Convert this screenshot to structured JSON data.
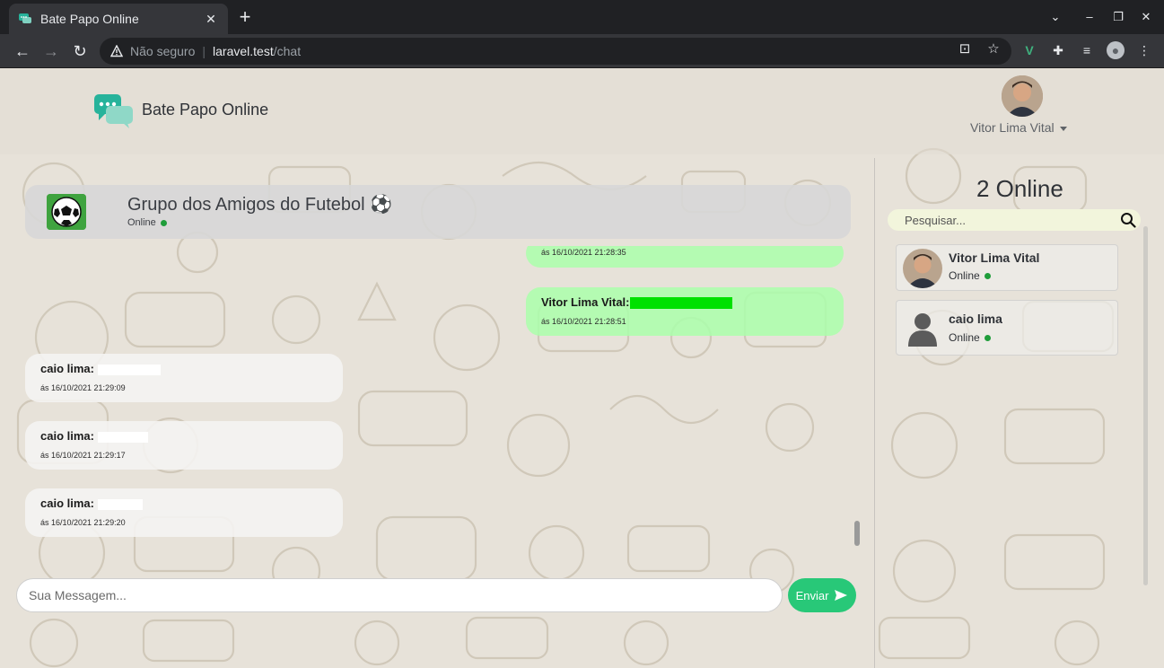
{
  "browser": {
    "tab_title": "Bate Papo Online",
    "tab_close": "✕",
    "new_tab": "+",
    "security_label": "Não seguro",
    "url_host": "laravel.test",
    "url_path": "/chat"
  },
  "nav": {
    "brand": "Bate Papo Online",
    "user_name": "Vitor Lima Vital"
  },
  "group": {
    "name": "Grupo dos Amigos do Futebol ⚽",
    "status": "Online"
  },
  "messages": [
    {
      "author": "",
      "text": "",
      "time": "ás 16/10/2021 21:28:35",
      "mine": true
    },
    {
      "author": "Vitor Lima Vital:",
      "text": "",
      "time": "ás 16/10/2021 21:28:51",
      "mine": true
    },
    {
      "author": "caio lima:",
      "text": "",
      "time": "ás 16/10/2021 21:29:09",
      "mine": false
    },
    {
      "author": "caio lima:",
      "text": "",
      "time": "ás 16/10/2021 21:29:17",
      "mine": false
    },
    {
      "author": "caio lima:",
      "text": "",
      "time": "ás 16/10/2021 21:29:20",
      "mine": false
    }
  ],
  "composer": {
    "placeholder": "Sua Messagem...",
    "send_label": "Enviar"
  },
  "sidebar": {
    "online_count": "2 Online",
    "search_placeholder": "Pesquisar...",
    "contacts": [
      {
        "name": "Vitor Lima Vital",
        "status": "Online"
      },
      {
        "name": "caio lima",
        "status": "Online"
      }
    ]
  },
  "colors": {
    "accent": "#28c878",
    "my_bubble": "#aaffaa",
    "online_dot": "#1f9d3a",
    "background": "#e7e2d9"
  },
  "icons": [
    "chat-bubbles-icon",
    "soccer-ball-icon",
    "send-arrow-icon",
    "search-icon",
    "user-silhouette-icon"
  ]
}
